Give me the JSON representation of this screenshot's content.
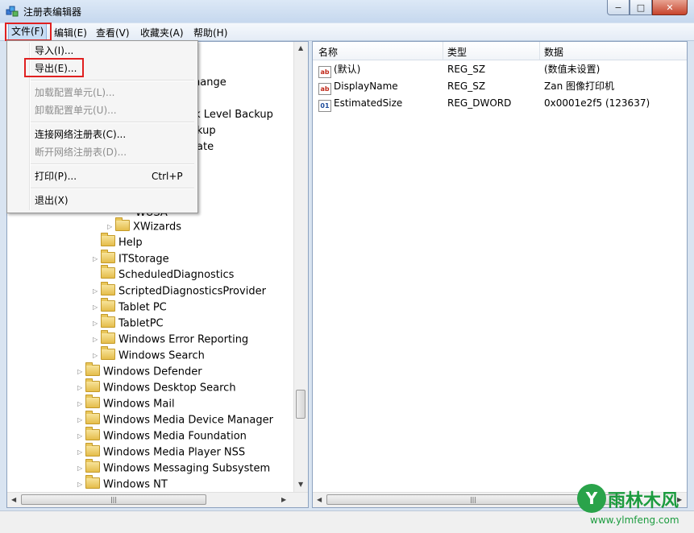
{
  "window": {
    "title": "注册表编辑器",
    "minimize": "−",
    "maximize": "□",
    "close": "✕"
  },
  "menubar": [
    "文件(F)",
    "编辑(E)",
    "查看(V)",
    "收藏夹(A)",
    "帮助(H)"
  ],
  "file_menu": {
    "items": [
      {
        "label": "导入(I)...",
        "shortcut": "",
        "enabled": true
      },
      {
        "label": "导出(E)...",
        "shortcut": "",
        "enabled": true
      },
      {
        "label": "加载配置单元(L)...",
        "shortcut": "",
        "enabled": false
      },
      {
        "label": "卸载配置单元(U)...",
        "shortcut": "",
        "enabled": false
      },
      {
        "label": "连接网络注册表(C)...",
        "shortcut": "",
        "enabled": true
      },
      {
        "label": "断开网络注册表(D)...",
        "shortcut": "",
        "enabled": false
      },
      {
        "label": "打印(P)...",
        "shortcut": "Ctrl+P",
        "enabled": true
      },
      {
        "label": "退出(X)",
        "shortcut": "",
        "enabled": true
      }
    ]
  },
  "tree": {
    "partial": [
      "hange",
      "ck Level Backup",
      "kup",
      "ate",
      "WUSA"
    ],
    "items": [
      {
        "label": "XWizards",
        "expandable": true
      },
      {
        "label": "Help",
        "expandable": false
      },
      {
        "label": "ITStorage",
        "expandable": true
      },
      {
        "label": "ScheduledDiagnostics",
        "expandable": false
      },
      {
        "label": "ScriptedDiagnosticsProvider",
        "expandable": true
      },
      {
        "label": "Tablet PC",
        "expandable": true
      },
      {
        "label": "TabletPC",
        "expandable": true
      },
      {
        "label": "Windows Error Reporting",
        "expandable": true
      },
      {
        "label": "Windows Search",
        "expandable": true
      },
      {
        "label": "Windows Defender",
        "expandable": true
      },
      {
        "label": "Windows Desktop Search",
        "expandable": true
      },
      {
        "label": "Windows Mail",
        "expandable": true
      },
      {
        "label": "Windows Media Device Manager",
        "expandable": true
      },
      {
        "label": "Windows Media Foundation",
        "expandable": true
      },
      {
        "label": "Windows Media Player NSS",
        "expandable": true
      },
      {
        "label": "Windows Messaging Subsystem",
        "expandable": true
      },
      {
        "label": "Windows NT",
        "expandable": true
      }
    ]
  },
  "list": {
    "columns": [
      "名称",
      "类型",
      "数据"
    ],
    "rows": [
      {
        "icon": "string-value-icon",
        "name": "(默认)",
        "type": "REG_SZ",
        "data": "(数值未设置)"
      },
      {
        "icon": "string-value-icon",
        "name": "DisplayName",
        "type": "REG_SZ",
        "data": "Zan 图像打印机"
      },
      {
        "icon": "binary-value-icon",
        "name": "EstimatedSize",
        "type": "REG_DWORD",
        "data": "0x0001e2f5 (123637)"
      }
    ]
  },
  "watermark": {
    "logo": "Y",
    "name": "雨林木风",
    "url": "www.ylmfeng.com"
  },
  "colors": {
    "highlight_box": "#e02020",
    "menu_active": "#c7dcf3"
  }
}
